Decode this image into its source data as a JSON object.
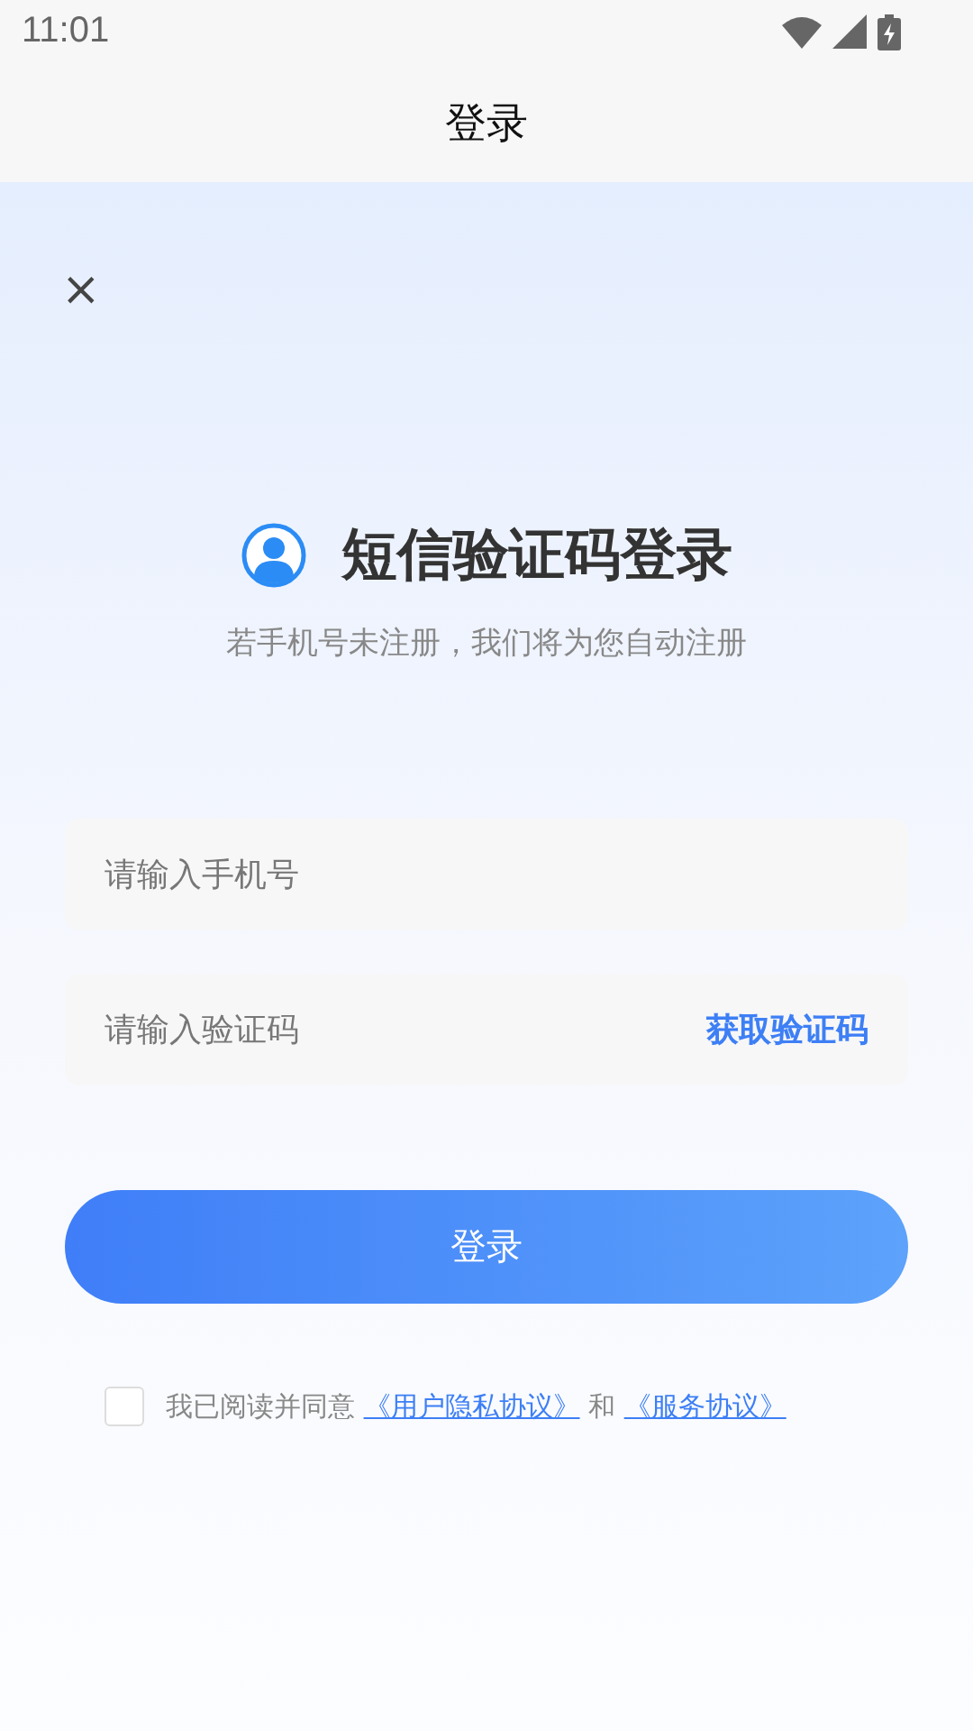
{
  "status_bar": {
    "time": "11:01"
  },
  "header": {
    "title": "登录"
  },
  "close": {
    "label": "×"
  },
  "heading": {
    "title": "短信验证码登录",
    "subtitle": "若手机号未注册，我们将为您自动注册"
  },
  "fields": [
    {
      "placeholder": "请输入手机号"
    },
    {
      "placeholder": "请输入验证码",
      "action": "获取验证码"
    }
  ],
  "login_button": {
    "label": "登录"
  },
  "agreement": {
    "checked": false,
    "parts": [
      {
        "kind": "text",
        "text": "我已阅读并同意 "
      },
      {
        "kind": "link",
        "text": "《用户隐私协议》"
      },
      {
        "kind": "text",
        "text": " 和 "
      },
      {
        "kind": "link",
        "text": "《服务协议》"
      }
    ]
  }
}
